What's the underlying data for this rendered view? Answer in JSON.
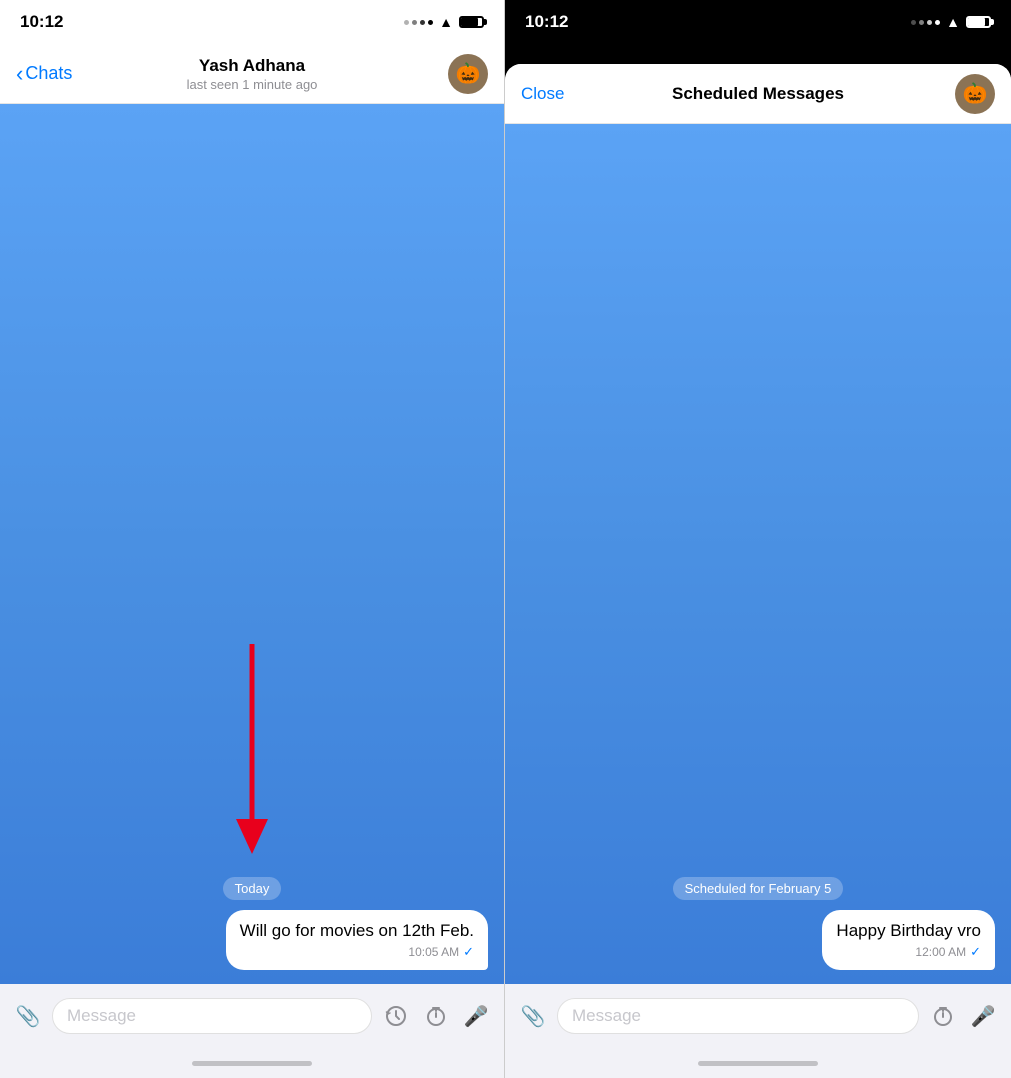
{
  "left_panel": {
    "status_time": "10:12",
    "nav_back_label": "Chats",
    "contact_name": "Yash Adhana",
    "last_seen": "last seen 1 minute ago",
    "date_chip": "Today",
    "message_text": "Will go for movies on 12th Feb.",
    "message_time": "10:05 AM",
    "input_placeholder": "Message",
    "avatar_emoji": "🎃"
  },
  "right_panel": {
    "status_time": "10:12",
    "nav_close_label": "Close",
    "title": "Scheduled Messages",
    "scheduled_chip": "Scheduled for February 5",
    "message_text": "Happy Birthday vro",
    "message_time": "12:00 AM",
    "input_placeholder": "Message",
    "avatar_emoji": "🎃"
  }
}
